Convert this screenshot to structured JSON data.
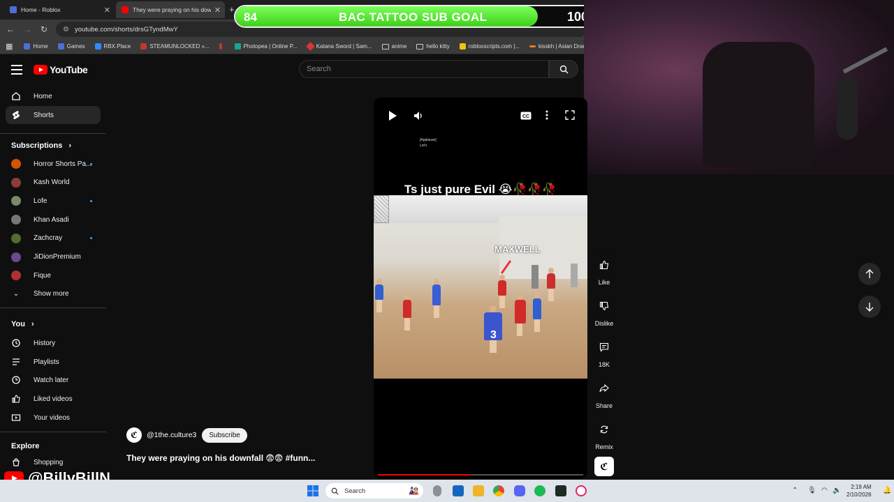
{
  "browser": {
    "tabs": [
      {
        "title": "Home - Roblox",
        "color": "#4a6fd8"
      },
      {
        "title": "They were praying on his down",
        "color": "#ff0000"
      }
    ],
    "url": "youtube.com/shorts/drsGTyndMwY",
    "bookmarks": [
      {
        "label": "Home",
        "color": "#4a6fd8"
      },
      {
        "label": "Games",
        "color": "#4a6fd8"
      },
      {
        "label": "RBX.Place",
        "color": "#2d8cff"
      },
      {
        "label": "STEAMUNLOCKED »...",
        "color": "#c0392b"
      },
      {
        "label": "",
        "color": "#c0392b"
      },
      {
        "label": "Photopea | Online P...",
        "color": "#18a497"
      },
      {
        "label": "Katana Sword | Sam...",
        "color": "#d33"
      },
      {
        "label": "anime",
        "color": "folder"
      },
      {
        "label": "hello kitty",
        "color": "folder"
      },
      {
        "label": "robloxscripts.com |...",
        "color": "#f1c40f"
      },
      {
        "label": "kisskh | Asian Dram...",
        "color": "#e67e22"
      }
    ]
  },
  "sub_goal": {
    "current": "84",
    "title": "BAC TATTOO SUB GOAL",
    "target": "100",
    "progress": 0.84
  },
  "youtube": {
    "logo_text": "YouTube",
    "search_placeholder": "Search",
    "nav": [
      {
        "label": "Home",
        "icon": "home-icon"
      },
      {
        "label": "Shorts",
        "icon": "shorts-icon",
        "active": true
      }
    ],
    "subscriptions_title": "Subscriptions",
    "subscriptions": [
      {
        "label": "Horror Shorts Pa...",
        "color": "#d35400",
        "dot": true
      },
      {
        "label": "Kash World",
        "color": "#8e3b3b",
        "dot": false
      },
      {
        "label": "Lofe",
        "color": "#7a8a6a",
        "dot": true
      },
      {
        "label": "Khan Asadi",
        "color": "#777",
        "dot": false
      },
      {
        "label": "Zachcray",
        "color": "#556b2f",
        "dot": true
      },
      {
        "label": "JiDionPremium",
        "color": "#6a4a8a",
        "dot": false
      },
      {
        "label": "Fique",
        "color": "#b03030",
        "dot": false
      }
    ],
    "show_more": "Show more",
    "you_title": "You",
    "you_items": [
      {
        "label": "History",
        "icon": "history-icon"
      },
      {
        "label": "Playlists",
        "icon": "playlists-icon"
      },
      {
        "label": "Watch later",
        "icon": "watch-later-icon"
      },
      {
        "label": "Liked videos",
        "icon": "like-icon"
      },
      {
        "label": "Your videos",
        "icon": "your-videos-icon"
      }
    ],
    "explore_title": "Explore",
    "explore_items": [
      {
        "label": "Shopping",
        "icon": "shopping-icon"
      }
    ],
    "short": {
      "overlay_title": "Ts just pure Evil 😭🥀🥀🥀",
      "name_tag": "MAXWELL",
      "jersey": "3",
      "subtitle_line1": "[Applause]",
      "subtitle_line2": "Let's",
      "channel_handle": "@1the.culture3",
      "subscribe_label": "Subscribe",
      "caption": "They were praying on his downfall 😨😨 #funn...",
      "progress": 0.45
    },
    "actions": [
      {
        "label": "Like",
        "icon": "thumbs-up-icon"
      },
      {
        "label": "Dislike",
        "icon": "thumbs-down-icon"
      },
      {
        "label": "18K",
        "icon": "comment-icon"
      },
      {
        "label": "Share",
        "icon": "share-icon"
      },
      {
        "label": "Remix",
        "icon": "remix-icon"
      }
    ]
  },
  "watermark": "@BillyBillN",
  "taskbar": {
    "search_label": "Search",
    "time": "2:19 AM",
    "date": "2/10/2026"
  }
}
